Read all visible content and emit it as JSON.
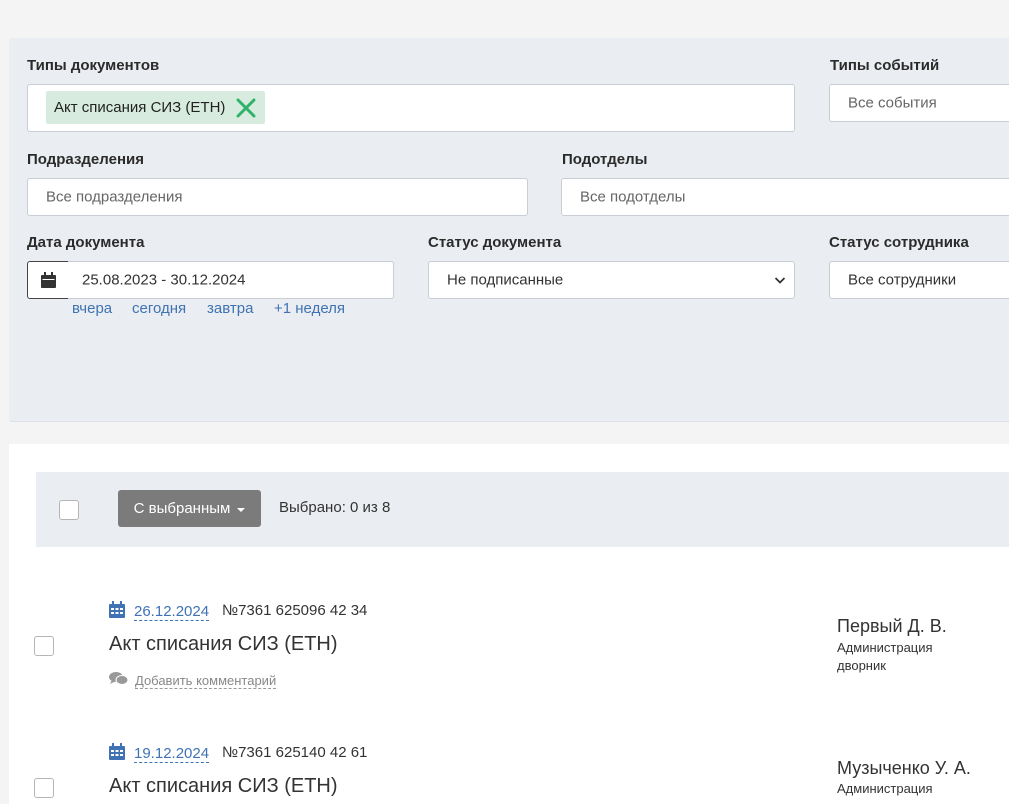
{
  "filters": {
    "doc_types": {
      "label": "Типы документов",
      "chip": "Акт списания СИЗ (ЕТН)"
    },
    "event_types": {
      "label": "Типы событий",
      "placeholder": "Все события"
    },
    "departments": {
      "label": "Подразделения",
      "placeholder": "Все подразделения"
    },
    "subdepartments": {
      "label": "Подотделы",
      "placeholder": "Все подотделы"
    },
    "doc_date": {
      "label": "Дата документа",
      "value": "25.08.2023 - 30.12.2024",
      "quick": [
        "вчера",
        "сегодня",
        "завтра",
        "+1 неделя"
      ]
    },
    "doc_status": {
      "label": "Статус документа",
      "value": "Не подписанные"
    },
    "employee_status": {
      "label": "Статус сотрудника",
      "value": "Все сотрудники"
    }
  },
  "toolbar": {
    "bulk_label": "С выбранным",
    "selected_text": "Выбрано: 0 из 8"
  },
  "documents": [
    {
      "date": "26.12.2024",
      "number": "№7361 625096 42 34",
      "title": "Акт списания СИЗ (ЕТН)",
      "comment": "Добавить комментарий",
      "person": {
        "name": "Первый Д. В.",
        "dept": "Администрация",
        "position": "дворник"
      }
    },
    {
      "date": "19.12.2024",
      "number": "№7361 625140 42 61",
      "title": "Акт списания СИЗ (ЕТН)",
      "person": {
        "name": "Музыченко У. А.",
        "dept": "Администрация"
      }
    }
  ],
  "colors": {
    "accent": "#3f73b3",
    "chip_bg": "#d7ecdf",
    "chip_x": "#2fb36b",
    "panel_bg": "#eaedf1",
    "bulk_btn": "#7b7b7b"
  }
}
